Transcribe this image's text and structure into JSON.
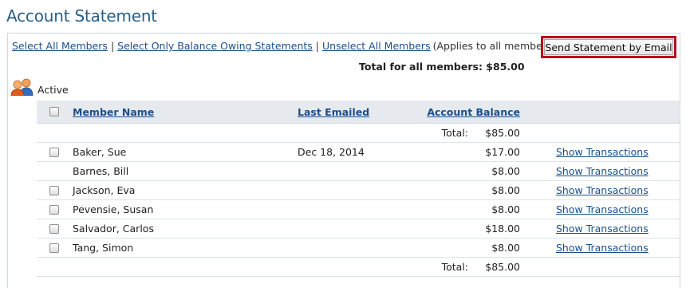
{
  "page": {
    "title": "Account Statement"
  },
  "toolbar": {
    "select_all": "Select All Members",
    "select_owing": "Select Only Balance Owing Statements",
    "unselect_all": "Unselect All Members",
    "separator": "|",
    "note": "(Applies to all member types)",
    "send_email": "Send Statement by Email"
  },
  "summary": {
    "total_all": "Total for all members: $85.00"
  },
  "group": {
    "label": "Active",
    "icon": "members-group-icon"
  },
  "table": {
    "headers": {
      "name": "Member Name",
      "last_emailed": "Last Emailed",
      "balance": "Account Balance"
    },
    "top_total": {
      "label": "Total:",
      "value": "$85.00"
    },
    "rows": [
      {
        "name": "Baker, Sue",
        "last_emailed": "Dec 18, 2014",
        "balance": "$17.00",
        "link": "Show Transactions",
        "has_checkbox": true
      },
      {
        "name": "Barnes, Bill",
        "last_emailed": "",
        "balance": "$8.00",
        "link": "Show Transactions",
        "has_checkbox": false
      },
      {
        "name": "Jackson, Eva",
        "last_emailed": "",
        "balance": "$8.00",
        "link": "Show Transactions",
        "has_checkbox": true
      },
      {
        "name": "Pevensie, Susan",
        "last_emailed": "",
        "balance": "$8.00",
        "link": "Show Transactions",
        "has_checkbox": true
      },
      {
        "name": "Salvador, Carlos",
        "last_emailed": "",
        "balance": "$18.00",
        "link": "Show Transactions",
        "has_checkbox": true
      },
      {
        "name": "Tang, Simon",
        "last_emailed": "",
        "balance": "$8.00",
        "link": "Show Transactions",
        "has_checkbox": true
      }
    ],
    "bottom_total": {
      "label": "Total:",
      "value": "$85.00"
    }
  },
  "colors": {
    "title": "#2a5e8c",
    "link": "#1a4f8b",
    "highlight_border": "#b3121e",
    "header_bg": "#e6eaee"
  }
}
